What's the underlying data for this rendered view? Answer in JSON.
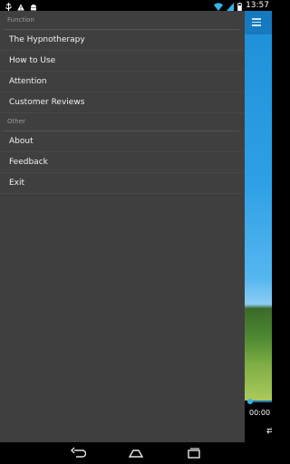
{
  "status_bar": {
    "time": "13:57",
    "icons": [
      "usb-icon",
      "warning-icon",
      "android-icon",
      "wifi-icon",
      "signal-icon",
      "battery-icon"
    ]
  },
  "drawer": {
    "sections": [
      {
        "header": "Function",
        "items": [
          "The Hypnotherapy",
          "How to Use",
          "Attention",
          "Customer Reviews"
        ]
      },
      {
        "header": "Other",
        "items": [
          "About",
          "Feedback",
          "Exit"
        ]
      }
    ]
  },
  "background_app": {
    "playback_time": "00:00"
  },
  "nav_bar": {
    "buttons": [
      "back-icon",
      "home-icon",
      "recent-apps-icon"
    ]
  },
  "colors": {
    "drawer_bg": "#3f3f3f",
    "header_text": "#9a9a9a",
    "item_text": "#f2f2f2",
    "accent": "#33b5e5"
  }
}
